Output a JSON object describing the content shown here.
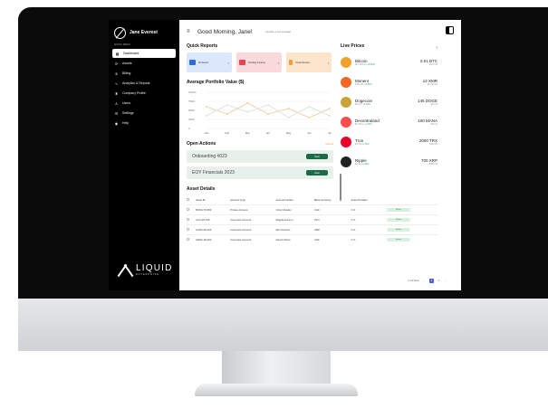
{
  "sidebar": {
    "user_name": "Jane Everest",
    "section_label": "QUICK MENU",
    "items": [
      {
        "label": "Dashboard",
        "icon": "grid-icon"
      },
      {
        "label": "Assets",
        "icon": "refresh-icon"
      },
      {
        "label": "Billing",
        "icon": "dollar-icon"
      },
      {
        "label": "Analytics & Reports",
        "icon": "chart-icon"
      },
      {
        "label": "Company Profile",
        "icon": "building-icon"
      },
      {
        "label": "Users",
        "icon": "user-icon"
      },
      {
        "label": "Settings",
        "icon": "sliders-icon"
      },
      {
        "label": "Help",
        "icon": "help-icon"
      }
    ],
    "logo_word": "LIQUID",
    "logo_sub": "ENTERPRISE"
  },
  "header": {
    "greeting": "Good Morning, Jane!",
    "message_placeholder": "you have 1 new message"
  },
  "quick_reports": {
    "title": "Quick Reports",
    "cards": [
      {
        "label": "All Assets",
        "color": "#2d6cdf"
      },
      {
        "label": "Pending Invoices",
        "color": "#e04550"
      },
      {
        "label": "Under Review",
        "color": "#f29d38"
      }
    ]
  },
  "portfolio": {
    "title": "Average Portfolio Value ($)"
  },
  "chart_data": {
    "type": "line",
    "title": "Average Portfolio Value ($)",
    "categories": [
      "Jan",
      "Feb",
      "Mar",
      "Apr",
      "May",
      "Jun",
      "Jul"
    ],
    "series": [
      {
        "values": [
          60000,
          40000,
          70000,
          40000,
          55000,
          30000,
          55000
        ]
      },
      {
        "values": [
          35000,
          65000,
          45000,
          65000,
          30000,
          60000,
          35000
        ]
      }
    ],
    "ytick_labels": [
      "100000",
      "75000",
      "50000",
      "25000",
      "0"
    ],
    "ylim": [
      0,
      100000
    ],
    "colors": [
      "#f0c98e",
      "#d8dde6"
    ],
    "grid": true
  },
  "open_actions": {
    "title": "Open Actions",
    "view_all": "View All",
    "items": [
      {
        "name": "Onboarding #023",
        "button": "Open"
      },
      {
        "name": "EOY Financials 2023",
        "button": "Open"
      }
    ]
  },
  "live_prices": {
    "title": "Live Prices",
    "coins": [
      {
        "name": "Bitcoin",
        "price": "$27,345.45",
        "change": "+3.50%",
        "amount": "0.01 BTC",
        "usd": "$273.45",
        "color": "#f2a12d",
        "icon": "bitcoin-icon"
      },
      {
        "name": "Monero",
        "price": "$150.08",
        "change": "+3.40%",
        "amount": "12 XMR",
        "usd": "$1,800.96",
        "color": "#f26822",
        "icon": "monero-icon"
      },
      {
        "name": "Dogecoin",
        "price": "$0.074",
        "change": "+2.10%",
        "amount": "145 DOGE",
        "usd": "$10.73",
        "color": "#c9a23a",
        "icon": "dogecoin-icon"
      },
      {
        "name": "Decentraland",
        "price": "$0.3412",
        "change": "+1.72%",
        "amount": "100 MANA",
        "usd": "$34.12",
        "color": "#ff4d4d",
        "icon": "decentraland-icon"
      },
      {
        "name": "Tron",
        "price": "$0.08",
        "change": "+1.71%",
        "amount": "2000 TRX",
        "usd": "$160.00",
        "color": "#eb0029",
        "icon": "tron-icon"
      },
      {
        "name": "Ripple",
        "price": "$0.50",
        "change": "+1.60%",
        "amount": "700 XRP",
        "usd": "$350.00",
        "color": "#222222",
        "icon": "ripple-icon"
      }
    ]
  },
  "asset_details": {
    "title": "Asset Details",
    "columns": [
      "Asset ID",
      "Account Type",
      "Account Holder",
      "Base Currency",
      "Asset Provider",
      ""
    ],
    "rows": [
      [
        "BUSS-78-583",
        "Private Account",
        "Victor Mueller",
        "CHF",
        "X.O",
        "Active"
      ],
      [
        "ACX-28-346",
        "Corporate Account",
        "Magda Duran-n",
        "PLN",
        "X.O",
        "Active"
      ],
      [
        "AADX-28-293",
        "Corporate Account",
        "Ebo Danofro",
        "GBP",
        "X.O",
        "Active"
      ],
      [
        "AROF-28-304",
        "Corporate Account",
        "David Olivan",
        "CHF",
        "X.O",
        "Active"
      ]
    ],
    "pager_text": "1-3 of items",
    "pages": [
      "‹",
      "1",
      "2",
      "›"
    ]
  }
}
